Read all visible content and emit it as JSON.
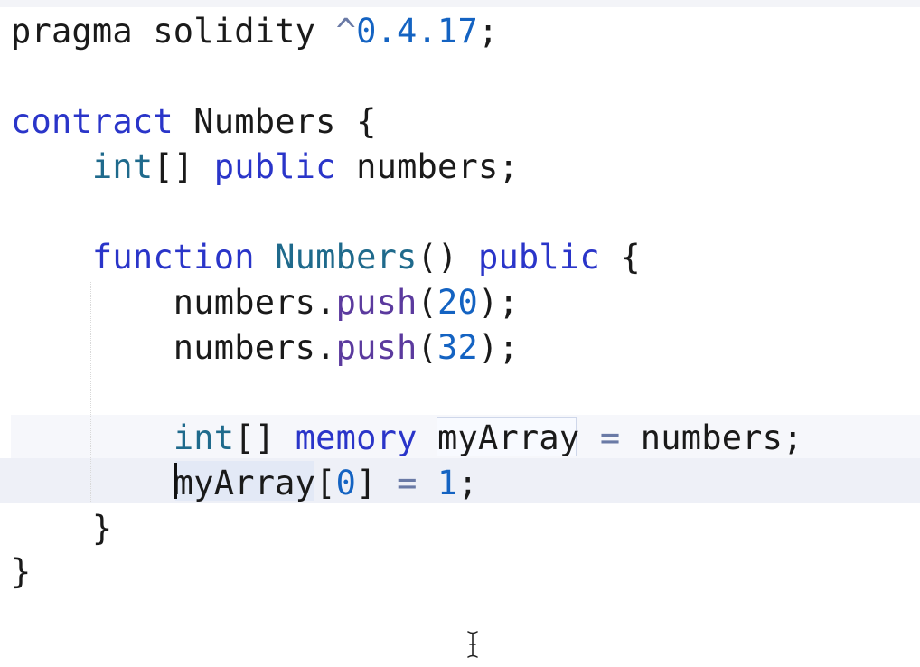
{
  "editor": {
    "language": "solidity",
    "lines": [
      {
        "tokens": [
          {
            "text": "pragma solidity ",
            "kind": "plain"
          },
          {
            "text": "^",
            "kind": "op"
          },
          {
            "text": "0.4.17",
            "kind": "num"
          },
          {
            "text": ";",
            "kind": "plain"
          }
        ]
      },
      {
        "tokens": []
      },
      {
        "tokens": [
          {
            "text": "contract",
            "kind": "kw"
          },
          {
            "text": " Numbers {",
            "kind": "plain"
          }
        ]
      },
      {
        "tokens": [
          {
            "text": "    ",
            "kind": "plain"
          },
          {
            "text": "int",
            "kind": "ty"
          },
          {
            "text": "[] ",
            "kind": "plain"
          },
          {
            "text": "public",
            "kind": "kw"
          },
          {
            "text": " numbers;",
            "kind": "plain"
          }
        ]
      },
      {
        "tokens": []
      },
      {
        "tokens": [
          {
            "text": "    ",
            "kind": "plain"
          },
          {
            "text": "function",
            "kind": "kw"
          },
          {
            "text": " ",
            "kind": "plain"
          },
          {
            "text": "Numbers",
            "kind": "ty"
          },
          {
            "text": "() ",
            "kind": "plain"
          },
          {
            "text": "public",
            "kind": "kw"
          },
          {
            "text": " {",
            "kind": "plain"
          }
        ]
      },
      {
        "tokens": [
          {
            "text": "        numbers.",
            "kind": "plain"
          },
          {
            "text": "push",
            "kind": "call"
          },
          {
            "text": "(",
            "kind": "plain"
          },
          {
            "text": "20",
            "kind": "num"
          },
          {
            "text": ");",
            "kind": "plain"
          }
        ]
      },
      {
        "tokens": [
          {
            "text": "        numbers.",
            "kind": "plain"
          },
          {
            "text": "push",
            "kind": "call"
          },
          {
            "text": "(",
            "kind": "plain"
          },
          {
            "text": "32",
            "kind": "num"
          },
          {
            "text": ");",
            "kind": "plain"
          }
        ]
      },
      {
        "tokens": []
      },
      {
        "tokens": [
          {
            "text": "        ",
            "kind": "plain"
          },
          {
            "text": "int",
            "kind": "ty"
          },
          {
            "text": "[] ",
            "kind": "plain"
          },
          {
            "text": "memory",
            "kind": "kw"
          },
          {
            "text": " myArray ",
            "kind": "plain"
          },
          {
            "text": "=",
            "kind": "op"
          },
          {
            "text": " numbers;",
            "kind": "plain"
          }
        ]
      },
      {
        "tokens": [
          {
            "text": "        myArray[",
            "kind": "plain"
          },
          {
            "text": "0",
            "kind": "num"
          },
          {
            "text": "] ",
            "kind": "plain"
          },
          {
            "text": "=",
            "kind": "op"
          },
          {
            "text": " ",
            "kind": "plain"
          },
          {
            "text": "1",
            "kind": "num"
          },
          {
            "text": ";",
            "kind": "plain"
          }
        ]
      },
      {
        "tokens": [
          {
            "text": "    }",
            "kind": "plain"
          }
        ]
      },
      {
        "tokens": [
          {
            "text": "}",
            "kind": "plain"
          }
        ]
      }
    ],
    "cursor_line": 11,
    "cursor_column": 9,
    "pointer": "text-cursor-icon"
  },
  "colors": {
    "keyword": "#2a35c9",
    "type": "#1f6a8c",
    "number": "#1463c2",
    "call": "#5b3a9e",
    "operator": "#6a7aa6",
    "text": "#1a1a1a",
    "current_line_highlight": "#eef0f7",
    "word_highlight": "#e3e9f6"
  }
}
